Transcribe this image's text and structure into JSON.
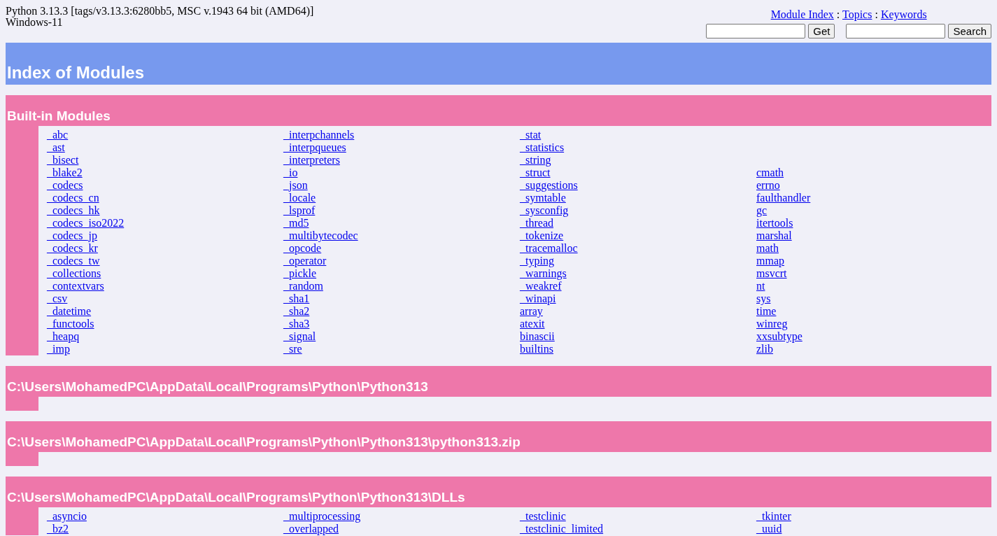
{
  "header": {
    "version": "Python 3.13.3 [tags/v3.13.3:6280bb5, MSC v.1943 64 bit (AMD64)]",
    "platform": "Windows-11",
    "nav_links": [
      "Module Index",
      "Topics",
      "Keywords"
    ],
    "separator": ":",
    "get_button": "Get",
    "search_button": "Search"
  },
  "title": "Index of Modules",
  "sections": [
    {
      "title": "Built-in Modules",
      "columns": [
        [
          "_abc",
          "_ast",
          "_bisect",
          "_blake2",
          "_codecs",
          "_codecs_cn",
          "_codecs_hk",
          "_codecs_iso2022",
          "_codecs_jp",
          "_codecs_kr",
          "_codecs_tw",
          "_collections",
          "_contextvars",
          "_csv",
          "_datetime",
          "_functools",
          "_heapq",
          "_imp"
        ],
        [
          "_interpchannels",
          "_interpqueues",
          "_interpreters",
          "_io",
          "_json",
          "_locale",
          "_lsprof",
          "_md5",
          "_multibytecodec",
          "_opcode",
          "_operator",
          "_pickle",
          "_random",
          "_sha1",
          "_sha2",
          "_sha3",
          "_signal",
          "_sre"
        ],
        [
          "_stat",
          "_statistics",
          "_string",
          "_struct",
          "_suggestions",
          "_symtable",
          "_sysconfig",
          "_thread",
          "_tokenize",
          "_tracemalloc",
          "_typing",
          "_warnings",
          "_weakref",
          "_winapi",
          "array",
          "atexit",
          "binascii",
          "builtins"
        ],
        [
          "cmath",
          "errno",
          "faulthandler",
          "gc",
          "itertools",
          "marshal",
          "math",
          "mmap",
          "msvcrt",
          "nt",
          "sys",
          "time",
          "winreg",
          "xxsubtype",
          "zlib"
        ]
      ]
    },
    {
      "title": "C:\\Users\\MohamedPC\\AppData\\Local\\Programs\\Python\\Python313"
    },
    {
      "title": "C:\\Users\\MohamedPC\\AppData\\Local\\Programs\\Python\\Python313\\python313.zip"
    },
    {
      "title": "C:\\Users\\MohamedPC\\AppData\\Local\\Programs\\Python\\Python313\\DLLs",
      "columns": [
        [
          "_asyncio",
          "_bz2"
        ],
        [
          "_multiprocessing",
          "_overlapped"
        ],
        [
          "_testclinic",
          "_testclinic_limited"
        ],
        [
          "_tkinter",
          "_uuid"
        ]
      ]
    }
  ]
}
